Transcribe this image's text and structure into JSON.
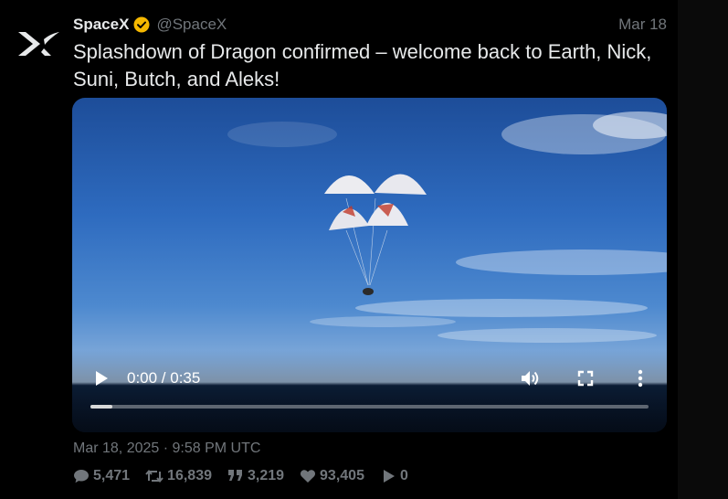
{
  "tweet": {
    "display_name": "SpaceX",
    "handle": "@SpaceX",
    "date_short": "Mar 18",
    "text": "Splashdown of Dragon confirmed – welcome back to Earth, Nick, Suni, Butch, and Aleks!",
    "timestamp": "Mar 18, 2025 · 9:58 PM UTC",
    "verified_color": "#f5b800"
  },
  "video": {
    "time": "0:00 / 0:35",
    "progress": 0.04
  },
  "stats": {
    "replies": "5,471",
    "retweets": "16,839",
    "quotes": "3,219",
    "likes": "93,405",
    "views": "0"
  },
  "icons": [
    "spacex-logo-icon",
    "verified-badge-icon",
    "play-icon",
    "volume-icon",
    "fullscreen-icon",
    "more-vertical-icon",
    "reply-icon",
    "retweet-icon",
    "quote-icon",
    "like-icon",
    "views-icon"
  ]
}
